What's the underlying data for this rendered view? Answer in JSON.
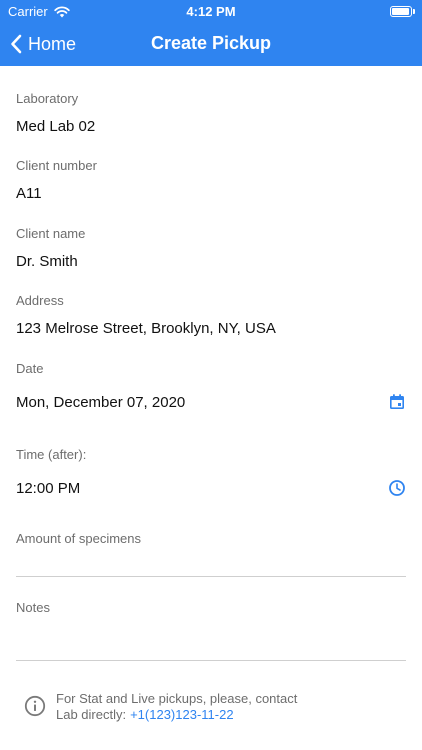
{
  "status_bar": {
    "carrier": "Carrier",
    "time": "4:12 PM",
    "battery_level": 0.95
  },
  "nav": {
    "back_label": "Home",
    "title": "Create Pickup"
  },
  "fields": {
    "laboratory": {
      "label": "Laboratory",
      "value": "Med Lab 02"
    },
    "client_number": {
      "label": "Client number",
      "value": "A11"
    },
    "client_name": {
      "label": "Client name",
      "value": "Dr. Smith"
    },
    "address": {
      "label": "Address",
      "value": "123 Melrose Street, Brooklyn, NY, USA"
    },
    "date": {
      "label": "Date",
      "value": "Mon, December 07, 2020",
      "icon": "calendar-icon"
    },
    "time": {
      "label": "Time (after):",
      "value": "12:00 PM",
      "icon": "clock-icon"
    },
    "specimens": {
      "label": "Amount of specimens",
      "value": ""
    },
    "notes": {
      "label": "Notes",
      "value": ""
    }
  },
  "info": {
    "line1": "For Stat and Live pickups, please, contact",
    "line2_prefix": "Lab directly:",
    "phone": "+1(123)123-11-22",
    "icon": "info-icon"
  },
  "colors": {
    "accent": "#2f84f0",
    "label": "#6d6d6d",
    "divider": "#cfcfcf"
  }
}
